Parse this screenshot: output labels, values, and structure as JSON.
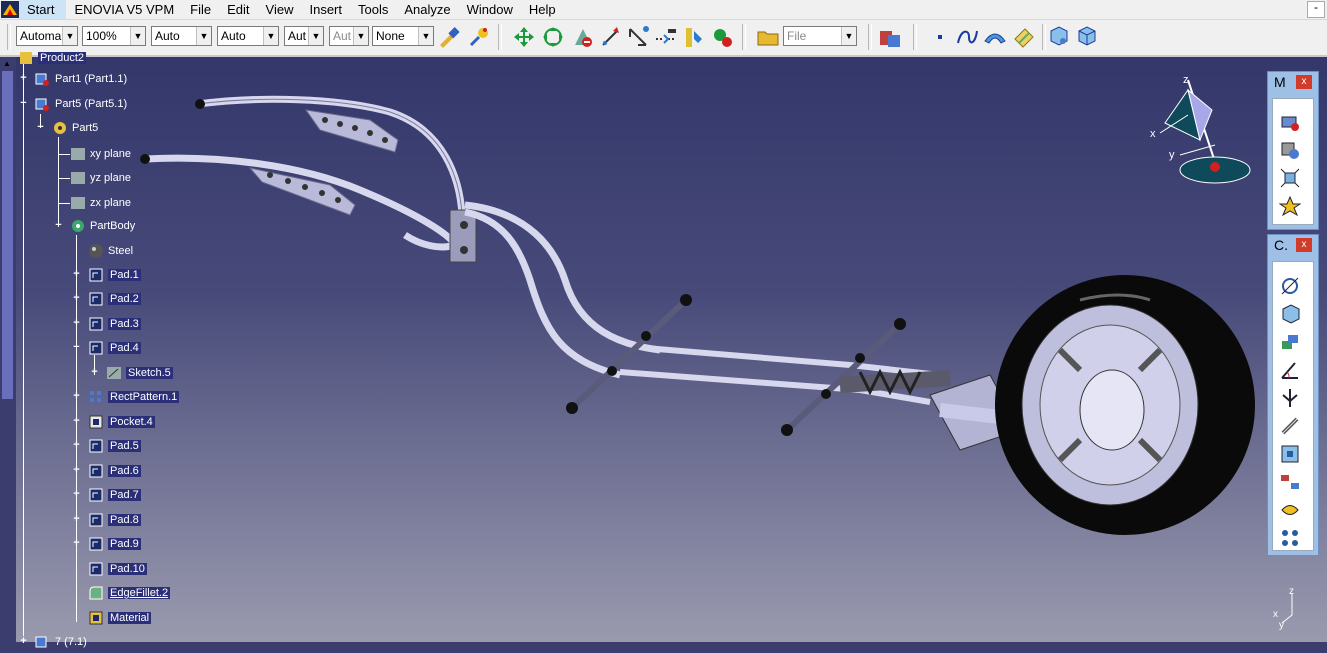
{
  "menubar": {
    "items": [
      "Start",
      "ENOVIA V5 VPM",
      "File",
      "Edit",
      "View",
      "Insert",
      "Tools",
      "Analyze",
      "Window",
      "Help"
    ],
    "minimize": "-"
  },
  "toolbar": {
    "combos": [
      "Automa",
      "100%",
      "Auto",
      "Auto",
      "Aut",
      "Aut",
      "None",
      "File"
    ]
  },
  "tree": {
    "root": "Product2",
    "nodes": [
      "Part1 (Part1.1)",
      "Part5 (Part5.1)",
      "Part5",
      "xy plane",
      "yz plane",
      "zx plane",
      "PartBody",
      "Steel",
      "Pad.1",
      "Pad.2",
      "Pad.3",
      "Pad.4",
      "Sketch.5",
      "RectPattern.1",
      "Pocket.4",
      "Pad.5",
      "Pad.6",
      "Pad.7",
      "Pad.8",
      "Pad.9",
      "Pad.10",
      "EdgeFillet.2",
      "Material",
      "7 (7.1)"
    ]
  },
  "compass": {
    "x": "x",
    "y": "y",
    "z": "z"
  },
  "mini_axis": {
    "x": "x",
    "y": "y",
    "z": "z"
  },
  "panels": {
    "m_title": "M",
    "c_title": "C.",
    "close": "x"
  },
  "colors": {
    "tree_text": "#ffffff",
    "highlight": "#2b2f77",
    "viewport_top": "#33376a",
    "panel": "#9ec0e6",
    "close": "#d23a2a"
  }
}
